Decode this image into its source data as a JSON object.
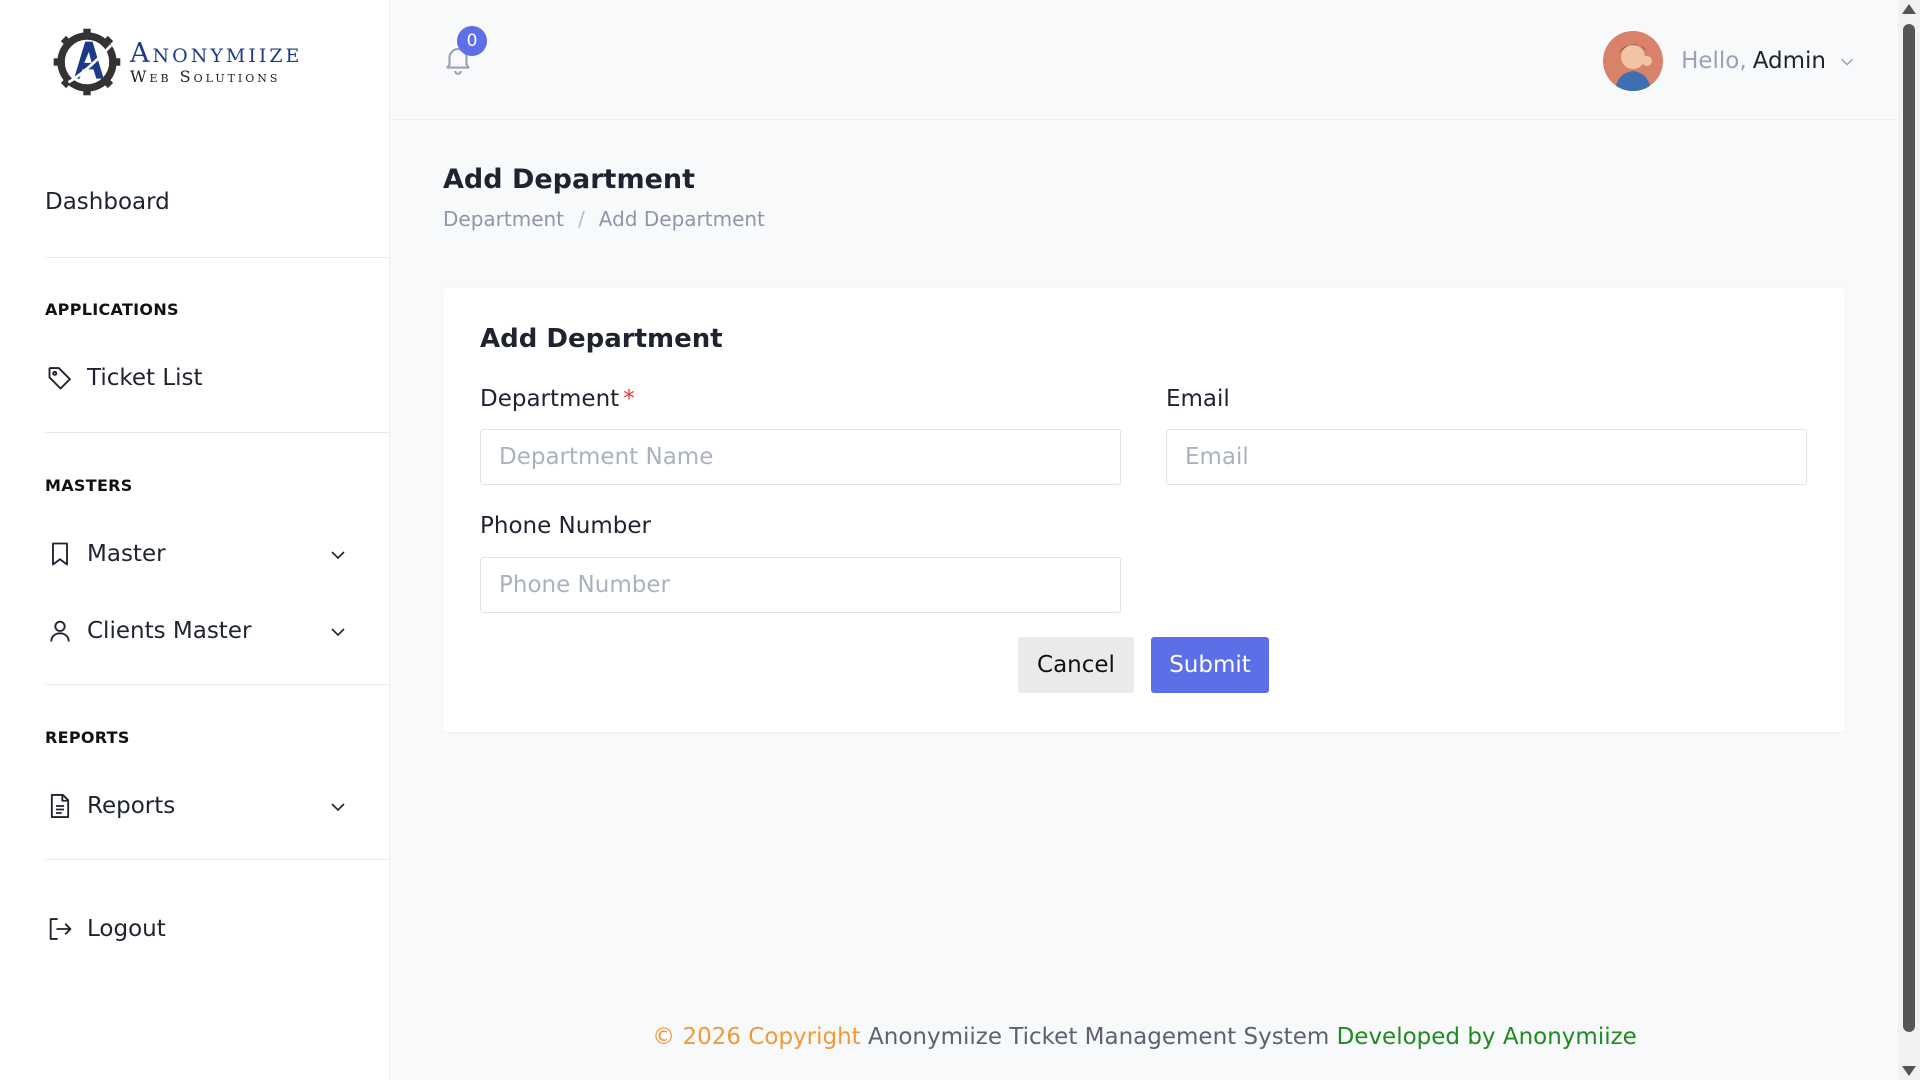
{
  "brand": {
    "name": "Anonymiize",
    "sub": "Web Solutions",
    "primary_color": "#1d3a8a",
    "gear_color": "#333333"
  },
  "sidebar": {
    "dashboard": {
      "label": "Dashboard"
    },
    "sections": {
      "applications": "APPLICATIONS",
      "masters": "MASTERS",
      "reports": "REPORTS"
    },
    "items": {
      "ticket_list": {
        "label": "Ticket List",
        "icon": "tag-icon"
      },
      "master": {
        "label": "Master",
        "icon": "bookmark-icon"
      },
      "clients_master": {
        "label": "Clients Master",
        "icon": "user-icon"
      },
      "reports": {
        "label": "Reports",
        "icon": "document-icon"
      },
      "logout": {
        "label": "Logout",
        "icon": "logout-icon"
      }
    }
  },
  "header": {
    "notifications_count": "0",
    "greeting": "Hello,",
    "user_name": "Admin",
    "accent_color": "#5c6fe6"
  },
  "page": {
    "title": "Add Department",
    "breadcrumb": [
      "Department",
      "/",
      "Add Department"
    ]
  },
  "form": {
    "title": "Add Department",
    "department": {
      "label": "Department",
      "required_mark": "*",
      "placeholder": "Department Name",
      "value": ""
    },
    "email": {
      "label": "Email",
      "placeholder": "Email",
      "value": ""
    },
    "phone": {
      "label": "Phone Number",
      "placeholder": "Phone Number",
      "value": ""
    },
    "cancel_label": "Cancel",
    "submit_label": "Submit"
  },
  "footer": {
    "copyright": "© 2026 Copyright",
    "system_name": "Anonymiize Ticket Management System",
    "developed_by": "Developed by Anonymiize"
  }
}
